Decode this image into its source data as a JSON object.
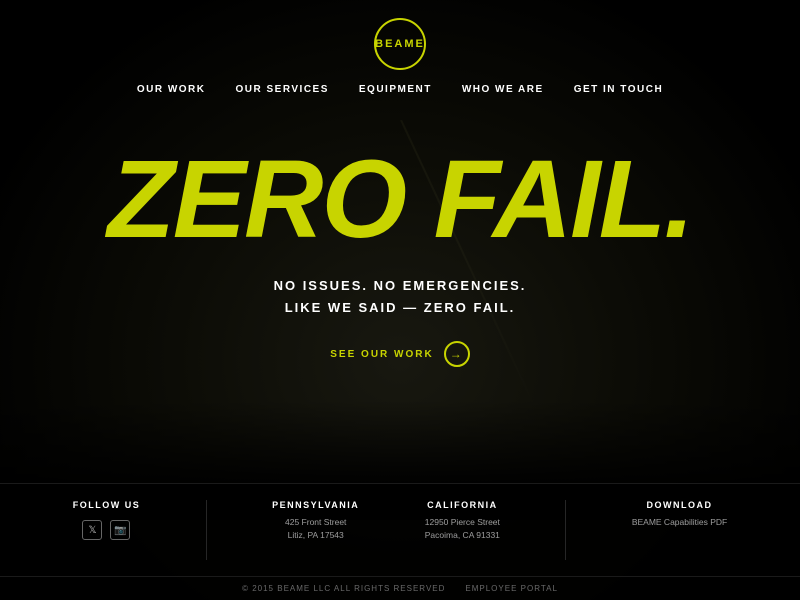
{
  "logo": {
    "text": "BEAME",
    "aria": "Beame logo"
  },
  "nav": {
    "items": [
      {
        "label": "OUR WORK",
        "id": "our-work"
      },
      {
        "label": "OUR SERVICES",
        "id": "our-services"
      },
      {
        "label": "EQUIPMENT",
        "id": "equipment"
      },
      {
        "label": "WHO WE ARE",
        "id": "who-we-are"
      },
      {
        "label": "GET IN TOUCH",
        "id": "get-in-touch"
      }
    ]
  },
  "hero": {
    "title": "ZERO FAIL.",
    "subtitle_line1": "NO ISSUES. NO EMERGENCIES.",
    "subtitle_line2": "LIKE WE SAID — ZERO FAIL.",
    "cta_label": "SEE OUR WORK"
  },
  "footer": {
    "follow_us": {
      "heading": "FOLLOW US"
    },
    "pennsylvania": {
      "heading": "PENNSYLVANIA",
      "address_line1": "425 Front Street",
      "address_line2": "Litiz, PA 17543"
    },
    "california": {
      "heading": "CALIFORNIA",
      "address_line1": "12950 Pierce Street",
      "address_line2": "Pacoima, CA 91331"
    },
    "download": {
      "heading": "DOWNLOAD",
      "link_label": "BEAME Capabilities PDF"
    },
    "copyright": "© 2015 BEAME LLC   ALL RIGHTS RESERVED",
    "employee_portal": "EMPLOYEE PORTAL"
  },
  "colors": {
    "accent": "#c8d400",
    "bg": "#000000",
    "text_primary": "#ffffff",
    "text_muted": "rgba(255,255,255,0.5)"
  }
}
